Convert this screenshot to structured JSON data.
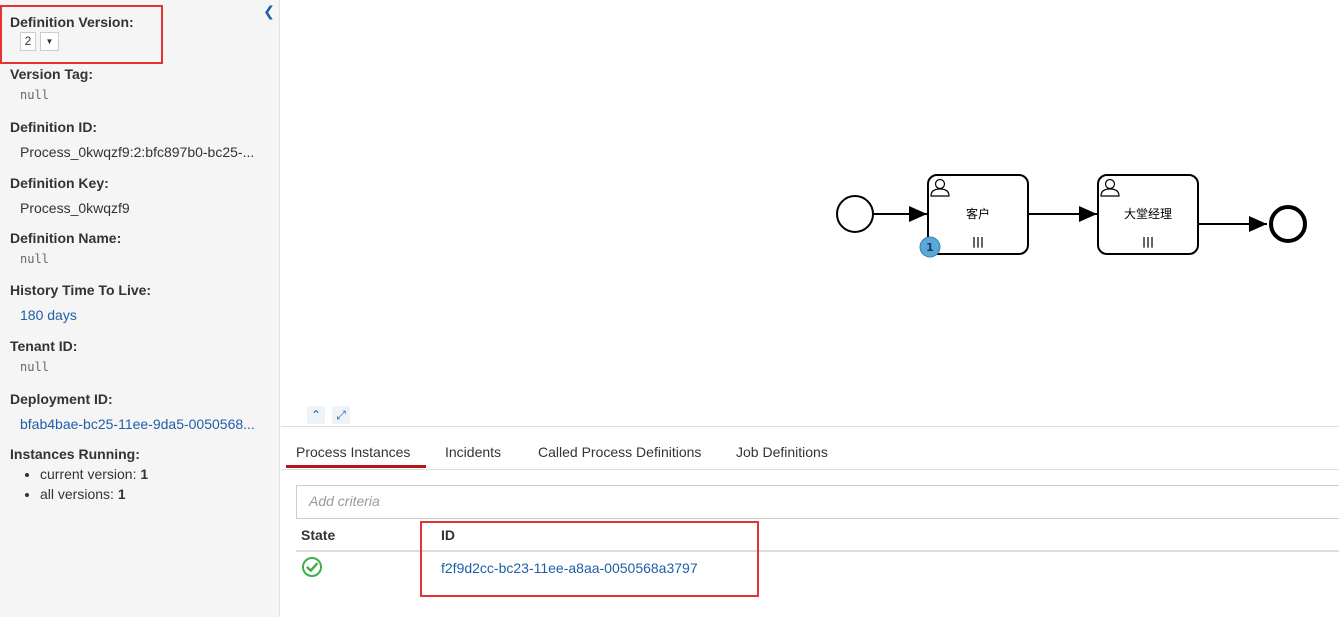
{
  "sidebar": {
    "definition_version_label": "Definition Version:",
    "definition_version_value": "2",
    "version_tag_label": "Version Tag:",
    "version_tag_value": "null",
    "definition_id_label": "Definition ID:",
    "definition_id_value": "Process_0kwqzf9:2:bfc897b0-bc25-...",
    "definition_key_label": "Definition Key:",
    "definition_key_value": "Process_0kwqzf9",
    "definition_name_label": "Definition Name:",
    "definition_name_value": "null",
    "history_ttl_label": "History Time To Live:",
    "history_ttl_value": "180 days",
    "tenant_id_label": "Tenant ID:",
    "tenant_id_value": "null",
    "deployment_id_label": "Deployment ID:",
    "deployment_id_value": "bfab4bae-bc25-11ee-9da5-0050568...",
    "instances_running_label": "Instances Running:",
    "current_version_label": "current version:",
    "current_version_value": "1",
    "all_versions_label": "all versions:",
    "all_versions_value": "1"
  },
  "diagram": {
    "task1_label": "客户",
    "task2_label": "大堂经理",
    "task1_badge": "1",
    "multi_instance_marker": "|||"
  },
  "tabs": [
    {
      "label": "Process Instances",
      "active": true
    },
    {
      "label": "Incidents",
      "active": false
    },
    {
      "label": "Called Process Definitions",
      "active": false
    },
    {
      "label": "Job Definitions",
      "active": false
    }
  ],
  "search": {
    "placeholder": "Add criteria"
  },
  "table": {
    "headers": {
      "state": "State",
      "id": "ID"
    },
    "rows": [
      {
        "state": "ok",
        "id": "f2f9d2cc-bc23-11ee-a8aa-0050568a3797"
      }
    ]
  },
  "colors": {
    "link": "#1f5fa8",
    "active_tab": "#b5151b",
    "highlight_box": "#e53333",
    "badge": "#5ba8d8",
    "success": "#3fae49"
  }
}
